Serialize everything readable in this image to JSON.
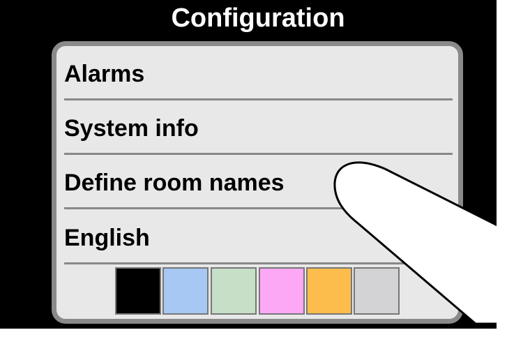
{
  "header": {
    "title": "Configuration"
  },
  "menu": {
    "items": [
      {
        "label": "Alarms"
      },
      {
        "label": "System info"
      },
      {
        "label": "Define room names"
      },
      {
        "label": "English"
      }
    ]
  },
  "theme_swatches": [
    {
      "name": "black",
      "color": "#000000"
    },
    {
      "name": "light-blue",
      "color": "#a6c8f2"
    },
    {
      "name": "light-green",
      "color": "#c6dfc6"
    },
    {
      "name": "pink",
      "color": "#fca8f5"
    },
    {
      "name": "orange",
      "color": "#fdbd4c"
    },
    {
      "name": "light-gray",
      "color": "#d3d2d4"
    }
  ],
  "overlay": {
    "icon": "pointing-finger-icon"
  }
}
